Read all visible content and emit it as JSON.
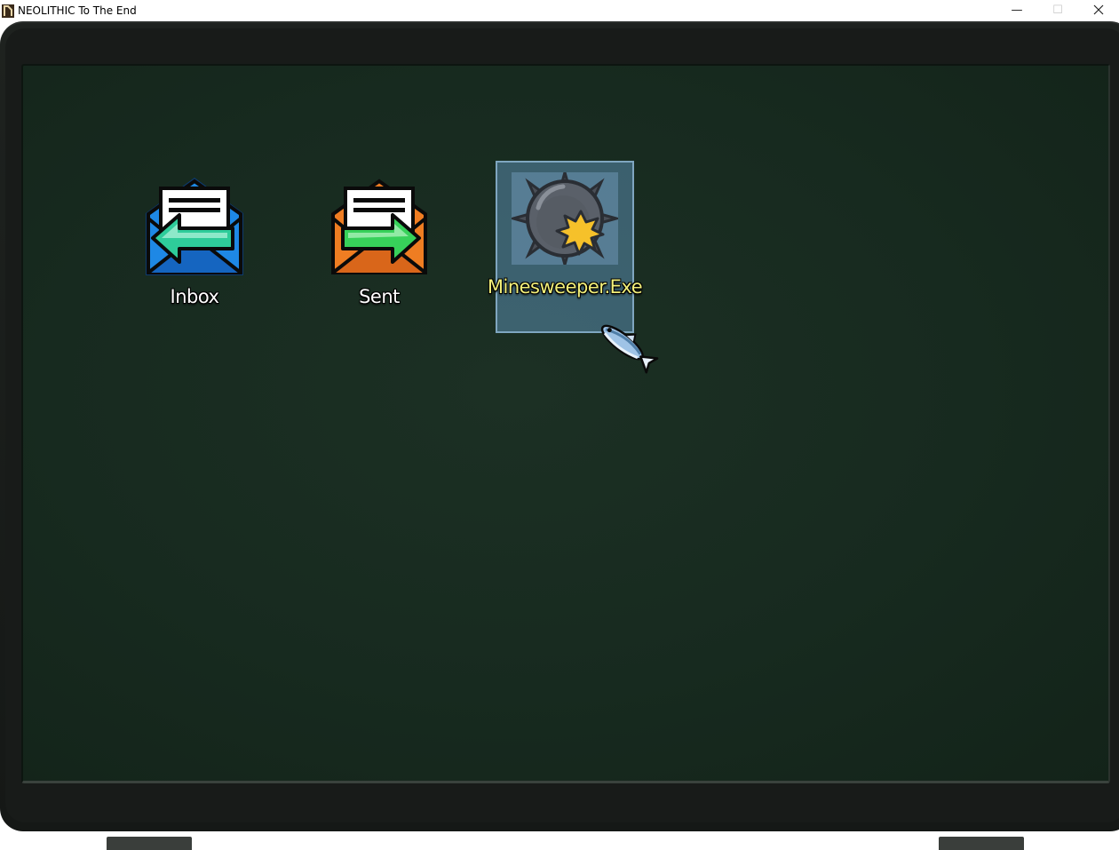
{
  "window": {
    "title": "NEOLITHIC To The End",
    "minimize_glyph": "—",
    "maximize_glyph": "☐"
  },
  "desktop": {
    "icons": [
      {
        "label": "Inbox",
        "icon": "mail-inbox-icon",
        "color": "#1e88e5",
        "arrow_color": "#2ecc9a"
      },
      {
        "label": "Sent",
        "icon": "mail-sent-icon",
        "color": "#ef7d22",
        "arrow_color": "#37d15a"
      },
      {
        "label": "Minesweeper.Exe",
        "icon": "mine-bomb-icon",
        "selected": true
      }
    ]
  },
  "cursor": {
    "icon": "fish-cursor-icon"
  },
  "colors": {
    "screen": "#172a1f",
    "bezel": "#181b19",
    "selection": "#5a8caf",
    "selected_label": "#f3f07a"
  }
}
